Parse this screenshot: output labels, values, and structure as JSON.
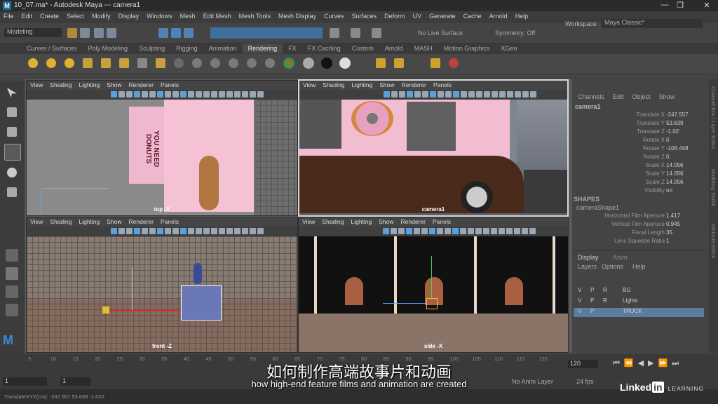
{
  "window": {
    "title": "10_07.ma* - Autodesk Maya  ---  camera1",
    "logo_letter": "M",
    "minimize": "—",
    "maximize": "❐",
    "close": "✕"
  },
  "menubar": [
    "File",
    "Edit",
    "Create",
    "Select",
    "Modify",
    "Display",
    "Windows",
    "Mesh",
    "Edit Mesh",
    "Mesh Tools",
    "Mesh Display",
    "Curves",
    "Surfaces",
    "Deform",
    "UV",
    "Generate",
    "Cache",
    "Arnold",
    "Help"
  ],
  "statusline": {
    "mode": "Modeling",
    "live_surface": "No Live Surface",
    "symmetry": "Symmetry: Off",
    "workspace_label": "Workspace :",
    "workspace_value": "Maya Classic*"
  },
  "shelf_tabs": [
    "Curves / Surfaces",
    "Poly Modeling",
    "Sculpting",
    "Rigging",
    "Animation",
    "Rendering",
    "FX",
    "FX Caching",
    "Custom",
    "Arnold",
    "MASH",
    "Motion Graphics",
    "XGen"
  ],
  "shelf_active": "Rendering",
  "viewport_menu": [
    "View",
    "Shading",
    "Lighting",
    "Show",
    "Renderer",
    "Panels"
  ],
  "viewports": {
    "top": {
      "label": "top -Y",
      "donut_text": "YOU NEED DONUTS"
    },
    "camera": {
      "label": "camera1"
    },
    "front": {
      "label": "front -Z"
    },
    "side": {
      "label": "side -X"
    }
  },
  "channel_box": {
    "tabs": [
      "Channels",
      "Edit",
      "Object",
      "Show"
    ],
    "object": "camera1",
    "attributes": [
      {
        "name": "Translate X",
        "value": "-247.557"
      },
      {
        "name": "Translate Y",
        "value": "53.639"
      },
      {
        "name": "Translate Z",
        "value": "-1.02"
      },
      {
        "name": "Rotate X",
        "value": "0"
      },
      {
        "name": "Rotate Y",
        "value": "-106.448"
      },
      {
        "name": "Rotate Z",
        "value": "0"
      },
      {
        "name": "Scale X",
        "value": "14.056"
      },
      {
        "name": "Scale Y",
        "value": "14.056"
      },
      {
        "name": "Scale Z",
        "value": "14.056"
      },
      {
        "name": "Visibility",
        "value": "on"
      }
    ],
    "shapes_header": "SHAPES",
    "shape_name": "cameraShape1",
    "shape_attributes": [
      {
        "name": "Horizontal Film Aperture",
        "value": "1.417"
      },
      {
        "name": "Vertical Film Aperture",
        "value": "0.945"
      },
      {
        "name": "Focal Length",
        "value": "35"
      },
      {
        "name": "Lens Squeeze Ratio",
        "value": "1"
      }
    ]
  },
  "layer_editor": {
    "tabs": [
      "Display",
      "Anim"
    ],
    "menu": [
      "Layers",
      "Options",
      "Help"
    ],
    "layers": [
      {
        "v": "V",
        "p": "P",
        "r": "R",
        "name": "BG"
      },
      {
        "v": "V",
        "p": "P",
        "r": "R",
        "name": "Lights"
      },
      {
        "v": "V",
        "p": "P",
        "r": "",
        "name": "TRUCK"
      }
    ]
  },
  "side_tabs": [
    "Channel Box / Layer Editor",
    "Modeling Toolkit",
    "Attribute Editor"
  ],
  "timeline": {
    "ticks": [
      "5",
      "10",
      "15",
      "20",
      "25",
      "30",
      "35",
      "40",
      "45",
      "50",
      "55",
      "60",
      "65",
      "70",
      "75",
      "80",
      "85",
      "90",
      "95",
      "100",
      "105",
      "110",
      "115",
      "120"
    ],
    "start": "1",
    "start2": "1",
    "end_frame": "120",
    "anim_layer": "No Anim Layer",
    "fps": "24 fps"
  },
  "cmdline": {
    "readout": "TranslateXYZ(cm):   -247.557     53.639     -1.020"
  },
  "subtitles": {
    "chinese": "如何制作高端故事片和动画",
    "english": "how high-end feature films and animation are created"
  },
  "brand": {
    "name": "Linked",
    "in": "in",
    "learning": "LEARNING"
  },
  "colors": {
    "accent": "#5aa0dc",
    "truck_pink": "#f0b8cf",
    "chocolate": "#4a2a1a"
  }
}
